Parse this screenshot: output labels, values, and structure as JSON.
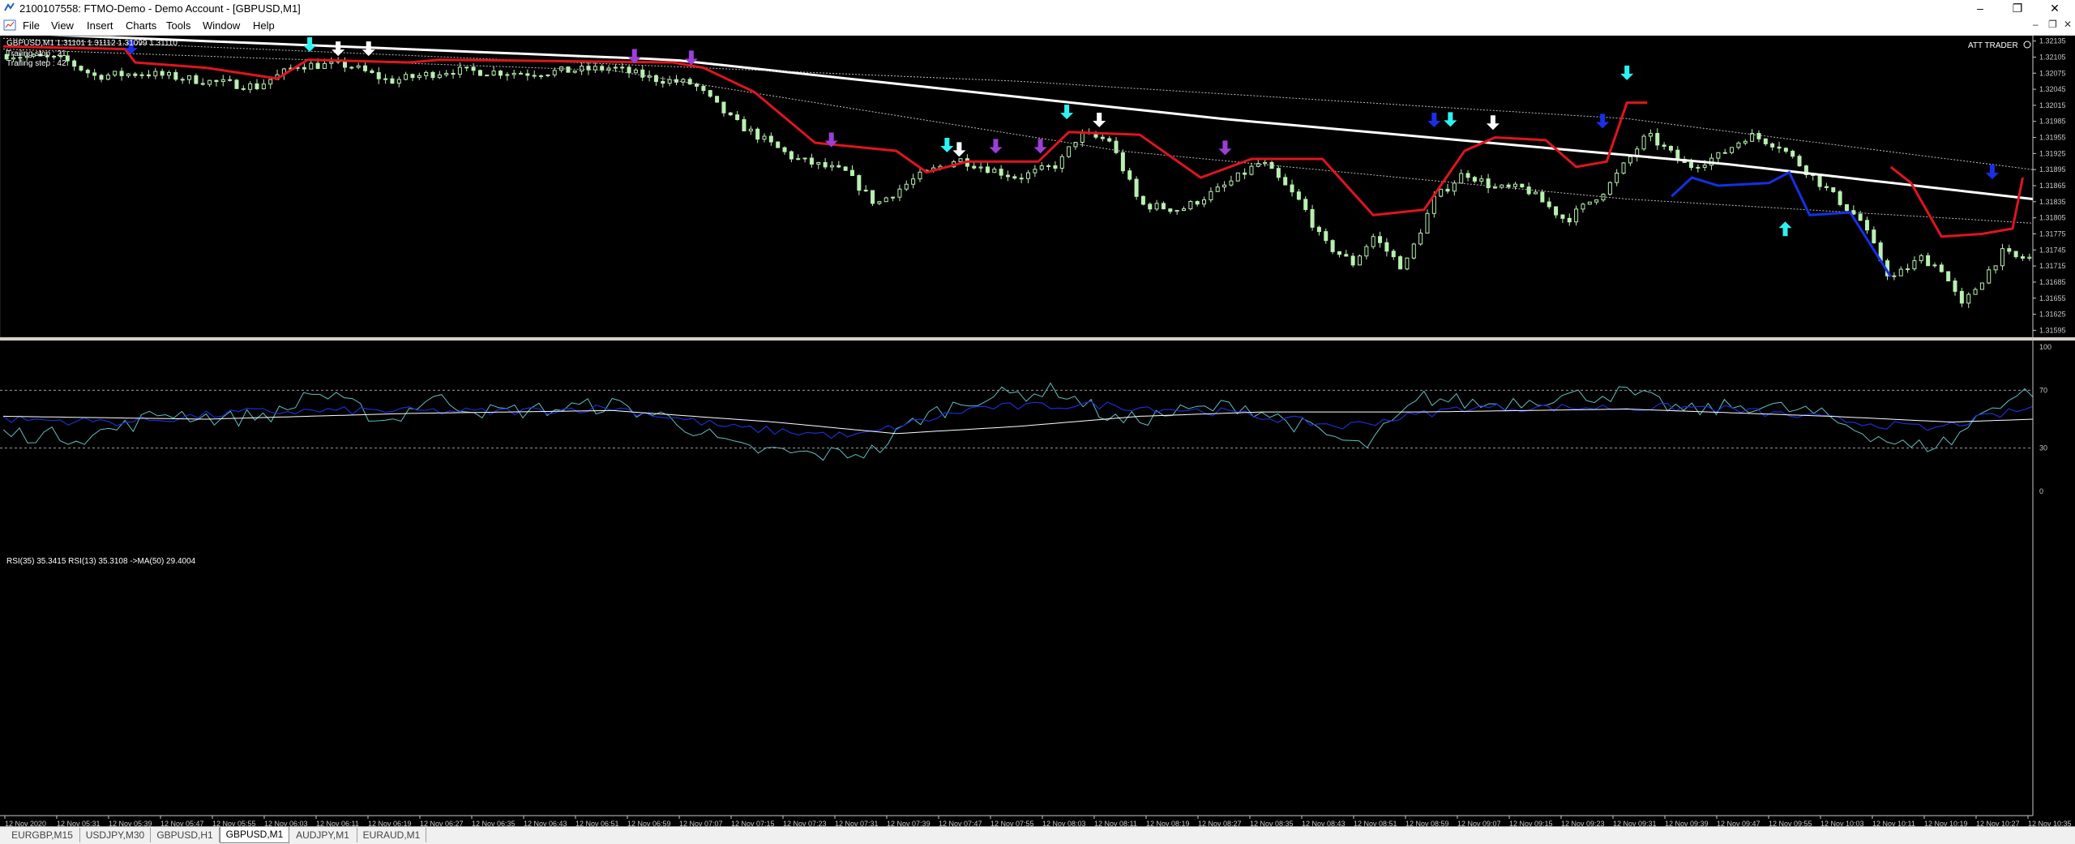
{
  "window": {
    "title": "2100107558: FTMO-Demo - Demo Account - [GBPUSD,M1]",
    "controls": {
      "minimize": "–",
      "maximize": "❐",
      "close": "✕"
    },
    "mdi_controls": {
      "minimize": "–",
      "restore": "❐",
      "close": "✕"
    }
  },
  "menu": [
    "File",
    "View",
    "Insert",
    "Charts",
    "Tools",
    "Window",
    "Help"
  ],
  "chart": {
    "symbol_info": "GBPUSD,M1  1.31101 1.31112 1.31099 1.31110",
    "trailing_stop": "Trailing stop : 21",
    "trailing_step": "Trailing step : 42",
    "indicator_name": "ATT TRADER",
    "subwindow_label": "RSI(35) 35.3415   RSI(13) 35.3108   ->MA(50) 29.4004",
    "price_labels": [
      "1.32135",
      "1.32105",
      "1.32075",
      "1.32045",
      "1.32015",
      "1.31985",
      "1.31955",
      "1.31925",
      "1.31895",
      "1.31865",
      "1.31835",
      "1.31805",
      "1.31775",
      "1.31745",
      "1.31715",
      "1.31685",
      "1.31655",
      "1.31625",
      "1.31595"
    ],
    "rsi_labels": [
      "100",
      "70",
      "30",
      "0"
    ],
    "time_labels": [
      "12 Nov 2020",
      "12 Nov 05:31",
      "12 Nov 05:39",
      "12 Nov 05:47",
      "12 Nov 05:55",
      "12 Nov 06:03",
      "12 Nov 06:11",
      "12 Nov 06:19",
      "12 Nov 06:27",
      "12 Nov 06:35",
      "12 Nov 06:43",
      "12 Nov 06:51",
      "12 Nov 06:59",
      "12 Nov 07:07",
      "12 Nov 07:15",
      "12 Nov 07:23",
      "12 Nov 07:31",
      "12 Nov 07:39",
      "12 Nov 07:47",
      "12 Nov 07:55",
      "12 Nov 08:03",
      "12 Nov 08:11",
      "12 Nov 08:19",
      "12 Nov 08:27",
      "12 Nov 08:35",
      "12 Nov 08:43",
      "12 Nov 08:51",
      "12 Nov 08:59",
      "12 Nov 09:07",
      "12 Nov 09:15",
      "12 Nov 09:23",
      "12 Nov 09:31",
      "12 Nov 09:39",
      "12 Nov 09:47",
      "12 Nov 09:55",
      "12 Nov 10:03",
      "12 Nov 10:11",
      "12 Nov 10:19",
      "12 Nov 10:27",
      "12 Nov 10:35"
    ],
    "colors": {
      "background": "#000000",
      "candles": "#b8f0b0",
      "trailing": "#e0141e",
      "trailing_alt": "#1430e6",
      "ma": "#ffffff",
      "rsi_fast": "#5fbfbf",
      "rsi_slow": "#1a2fd0",
      "rsi_ma": "#ffffff",
      "grid_text": "#c8c8c8"
    },
    "signal_arrows": [
      {
        "dir": "down",
        "color": "#1a2fe6",
        "t": 0.063,
        "v": 1.32113
      },
      {
        "dir": "down",
        "color": "#2ef2f2",
        "t": 0.151,
        "v": 1.32118
      },
      {
        "dir": "down",
        "color": "#ffffff",
        "t": 0.165,
        "v": 1.3211
      },
      {
        "dir": "down",
        "color": "#ffffff",
        "t": 0.18,
        "v": 1.3211
      },
      {
        "dir": "down",
        "color": "#9b3fd6",
        "t": 0.311,
        "v": 1.32096
      },
      {
        "dir": "down",
        "color": "#9b3fd6",
        "t": 0.339,
        "v": 1.32093
      },
      {
        "dir": "down",
        "color": "#9b3fd6",
        "t": 0.408,
        "v": 1.3194
      },
      {
        "dir": "down",
        "color": "#2ef2f2",
        "t": 0.465,
        "v": 1.3193
      },
      {
        "dir": "down",
        "color": "#ffffff",
        "t": 0.471,
        "v": 1.31922
      },
      {
        "dir": "down",
        "color": "#9b3fd6",
        "t": 0.489,
        "v": 1.31928
      },
      {
        "dir": "down",
        "color": "#9b3fd6",
        "t": 0.511,
        "v": 1.31928
      },
      {
        "dir": "down",
        "color": "#2ef2f2",
        "t": 0.524,
        "v": 1.31992
      },
      {
        "dir": "down",
        "color": "#ffffff",
        "t": 0.54,
        "v": 1.31977
      },
      {
        "dir": "down",
        "color": "#9b3fd6",
        "t": 0.602,
        "v": 1.31925
      },
      {
        "dir": "down",
        "color": "#1a2fe6",
        "t": 0.705,
        "v": 1.31977
      },
      {
        "dir": "down",
        "color": "#2ef2f2",
        "t": 0.713,
        "v": 1.31978
      },
      {
        "dir": "down",
        "color": "#ffffff",
        "t": 0.734,
        "v": 1.31972
      },
      {
        "dir": "down",
        "color": "#1a2fe6",
        "t": 0.788,
        "v": 1.31975
      },
      {
        "dir": "down",
        "color": "#2ef2f2",
        "t": 0.8,
        "v": 1.32065
      },
      {
        "dir": "up",
        "color": "#2ef2f2",
        "t": 0.878,
        "v": 1.31795
      },
      {
        "dir": "down",
        "color": "#1a2fe6",
        "t": 0.98,
        "v": 1.3188
      }
    ]
  },
  "tabs": [
    {
      "label": "EURGBP,M15",
      "active": false
    },
    {
      "label": "USDJPY,M30",
      "active": false
    },
    {
      "label": "GBPUSD,H1",
      "active": false
    },
    {
      "label": "GBPUSD,M1",
      "active": true
    },
    {
      "label": "AUDJPY,M1",
      "active": false
    },
    {
      "label": "EURAUD,M1",
      "active": false
    }
  ]
}
